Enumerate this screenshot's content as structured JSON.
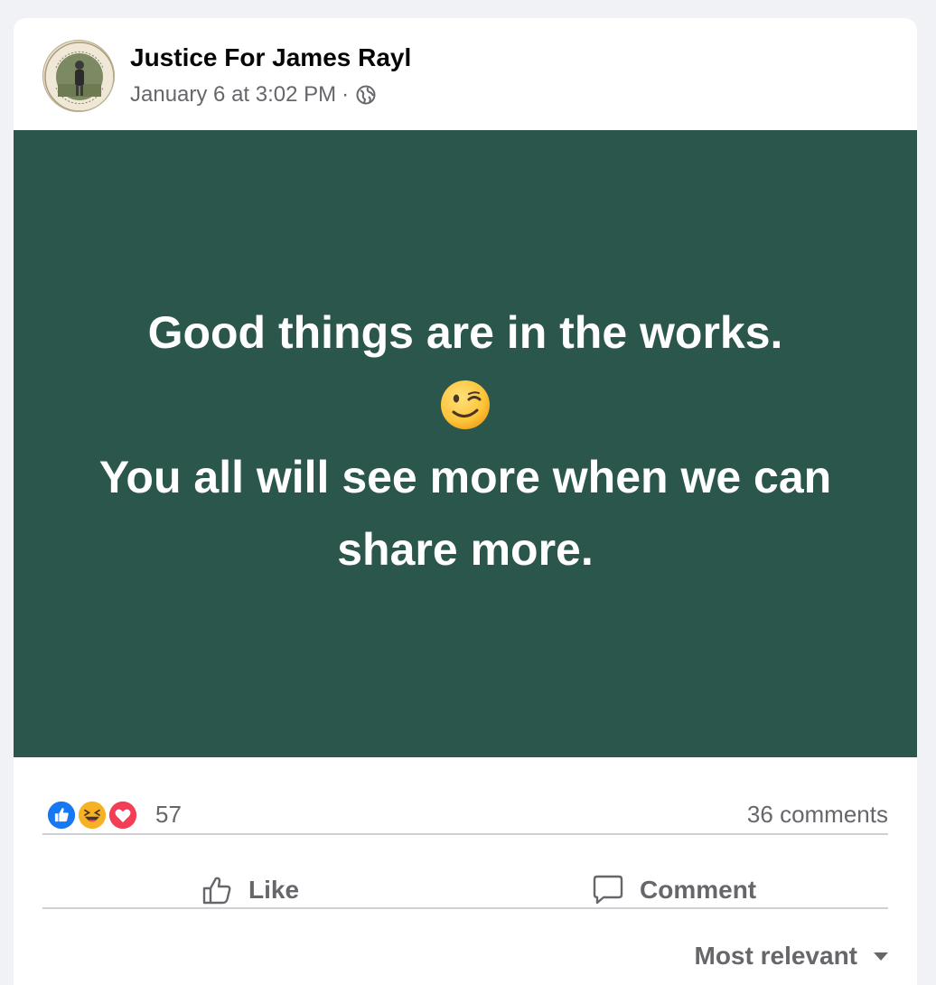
{
  "post": {
    "page_name": "Justice For James Rayl",
    "timestamp": "January 6 at 3:02 PM",
    "separator": "·",
    "privacy_icon": "globe-icon",
    "background_color": "#2a564b",
    "text_lines": [
      "Good things are in the works.",
      "You all will see more when we can share more."
    ],
    "emoji": "winking-face"
  },
  "reactions": {
    "types": [
      "like",
      "haha",
      "love"
    ],
    "count": "57",
    "comments": "36 comments"
  },
  "actions": {
    "like": "Like",
    "comment": "Comment"
  },
  "comments_sort": {
    "label": "Most relevant"
  },
  "colors": {
    "like_blue": "#1877f2",
    "love_red": "#f33e58",
    "haha_yellow": "#f7b125",
    "muted_text": "#65676b"
  }
}
